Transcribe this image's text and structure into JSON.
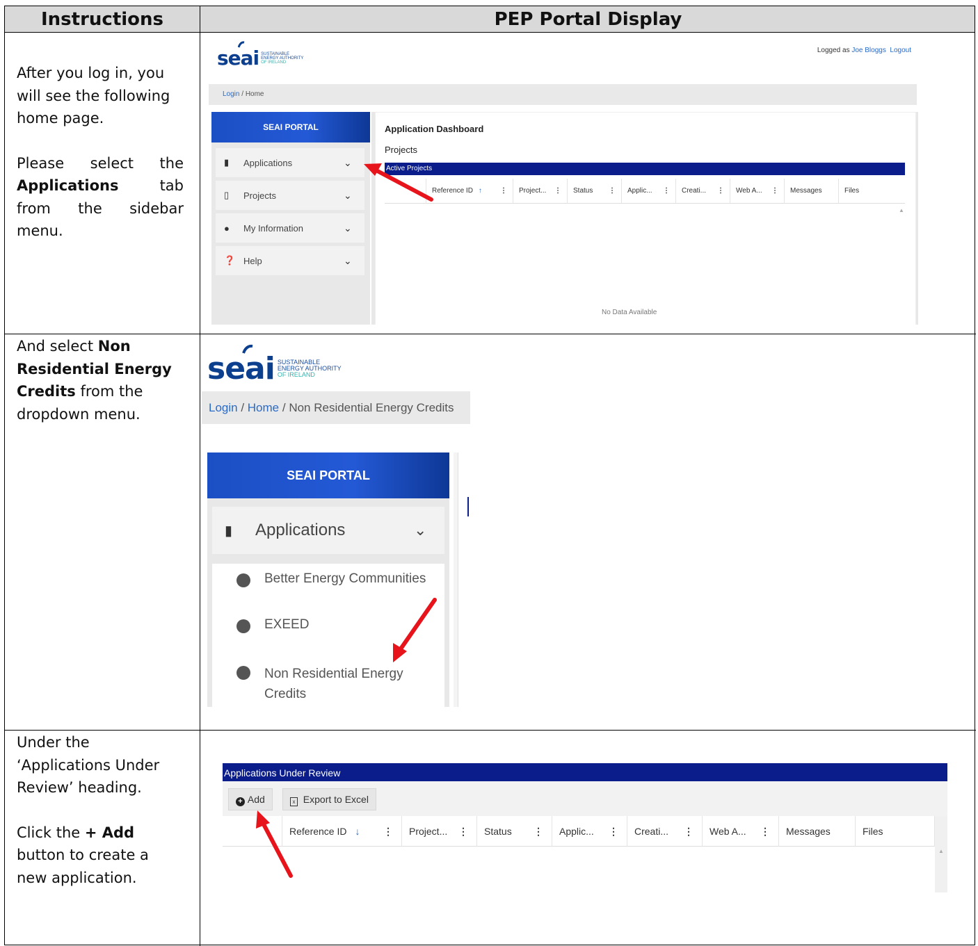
{
  "header": {
    "instructions": "Instructions",
    "display": "PEP Portal Display"
  },
  "rows": [
    {
      "instr": {
        "l1": "After you log in, you",
        "l2": "will see the following",
        "l3": "home page.",
        "l4a": "Please select the",
        "l5b": "Applications",
        "l5c": " tab",
        "l6": "from the sidebar",
        "l7": "menu."
      },
      "screen": {
        "logo_word": "seai",
        "logo_sub1": "SUSTAINABLE",
        "logo_sub2": "ENERGY AUTHORITY",
        "logo_sub3": "OF IRELAND",
        "logged_as": "Logged as ",
        "user": "Joe Bloggs",
        "logout": "Logout",
        "crumb_login": "Login",
        "crumb_sep": " / ",
        "crumb_home": "Home",
        "portal": "SEAI PORTAL",
        "menu": [
          "Applications",
          "Projects",
          "My Information",
          "Help"
        ],
        "dashboard_title": "Application Dashboard",
        "projects_title": "Projects",
        "active_projects": "Active Projects",
        "columns": [
          "Reference ID",
          "Project...",
          "Status",
          "Applic...",
          "Creati...",
          "Web A...",
          "Messages",
          "Files"
        ],
        "sort_arrow": "↑",
        "no_data": "No Data Available"
      }
    },
    {
      "instr": {
        "l1": "And select ",
        "l1b": "Non",
        "l2": "Residential Energy",
        "l3": "Credits",
        "l3b": " from the",
        "l4": "dropdown menu."
      },
      "screen": {
        "crumb_login": "Login",
        "crumb_home": "Home",
        "crumb_current": "Non Residential Energy Credits",
        "portal": "SEAI PORTAL",
        "menu_applications": "Applications",
        "submenu": [
          "Better Energy Communities",
          "EXEED",
          "Non Residential Energy",
          "Credits"
        ]
      }
    },
    {
      "instr": {
        "l1": "Under the",
        "l2": "‘Applications Under",
        "l3": "Review’ heading.",
        "l4a": "Click the ",
        "l4b": "+ Add",
        "l5": "button to create a",
        "l6": "new application."
      },
      "screen": {
        "section": "Applications Under Review",
        "add": "Add",
        "export": "Export to Excel",
        "columns": [
          "Reference ID",
          "Project...",
          "Status",
          "Applic...",
          "Creati...",
          "Web A...",
          "Messages",
          "Files"
        ],
        "sort_arrow": "↓"
      }
    }
  ],
  "colors": {
    "navy": "#0a1d8a",
    "portal_blue": "#2459d6",
    "link": "#2a6ac8",
    "arrow": "#e8141b"
  }
}
